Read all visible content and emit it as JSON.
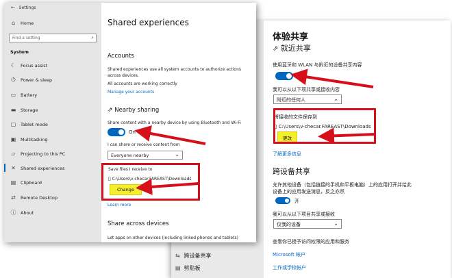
{
  "colors": {
    "accent": "#0067c0",
    "annotation_red": "#d6101a",
    "highlight_yellow": "#f5ee2e"
  },
  "cn": {
    "page_title": "体验共享",
    "nearby_heading": "就近共享",
    "nearby_desc": "使用蓝牙和 WLAN 与附近的设备共享内容",
    "toggle_label": "开",
    "receive_label": "我可以从以下项共享或接收内容",
    "receive_value": "附近的任何人",
    "save_label": "将接收的文件保存到",
    "save_path": "C:\\Users\\v-checar.FAREAST\\Downloads",
    "change_button": "更改",
    "learn_more": "了解更多信息",
    "cross_heading": "跨设备共享",
    "cross_desc_1": "允许其他设备（包括链接的手机和平板电脑）上的应用打开并给此",
    "cross_desc_2": "设备上的应用发送消息，反之亦然",
    "cross_toggle_label": "开",
    "cross_receive_label": "我可以从以下项目共享或接收",
    "cross_receive_value": "仅我的设备",
    "apps_label": "查看你已授予访问权限的应用和服务",
    "microsoft_account": "Microsoft 帐户",
    "work_account": "工作或学校帐户",
    "nav_clipboard": "剪贴板",
    "nav_clipboard_partial": "跨设备共享"
  },
  "en": {
    "app_title": "Settings",
    "nav": {
      "home": "Home",
      "search_placeholder": "Find a setting",
      "section": "System",
      "items": [
        "Focus assist",
        "Power & sleep",
        "Battery",
        "Storage",
        "Tablet mode",
        "Multitasking",
        "Projecting to this PC",
        "Shared experiences",
        "Clipboard",
        "Remote Desktop",
        "About"
      ]
    },
    "page_title": "Shared experiences",
    "accounts_heading": "Accounts",
    "accounts_desc_1": "Shared experiences use all system accounts to authorize actions",
    "accounts_desc_2": "across devices.",
    "accounts_status": "All accounts are working correctly",
    "manage_accounts": "Manage your accounts",
    "nearby_heading": "Nearby sharing",
    "nearby_desc": "Share content with a nearby device by using Bluetooth and Wi-Fi",
    "toggle_label": "On",
    "share_label": "I can share or receive content from",
    "share_value": "Everyone nearby",
    "save_label": "Save files I receive to",
    "save_path": "C:\\Users\\v-checar.FAREAST\\Downloads",
    "change_button": "Change",
    "learn_more": "Learn more",
    "share_across_heading": "Share across devices",
    "share_across_desc": "Let apps on other devices (including linked phones and tablets)"
  }
}
